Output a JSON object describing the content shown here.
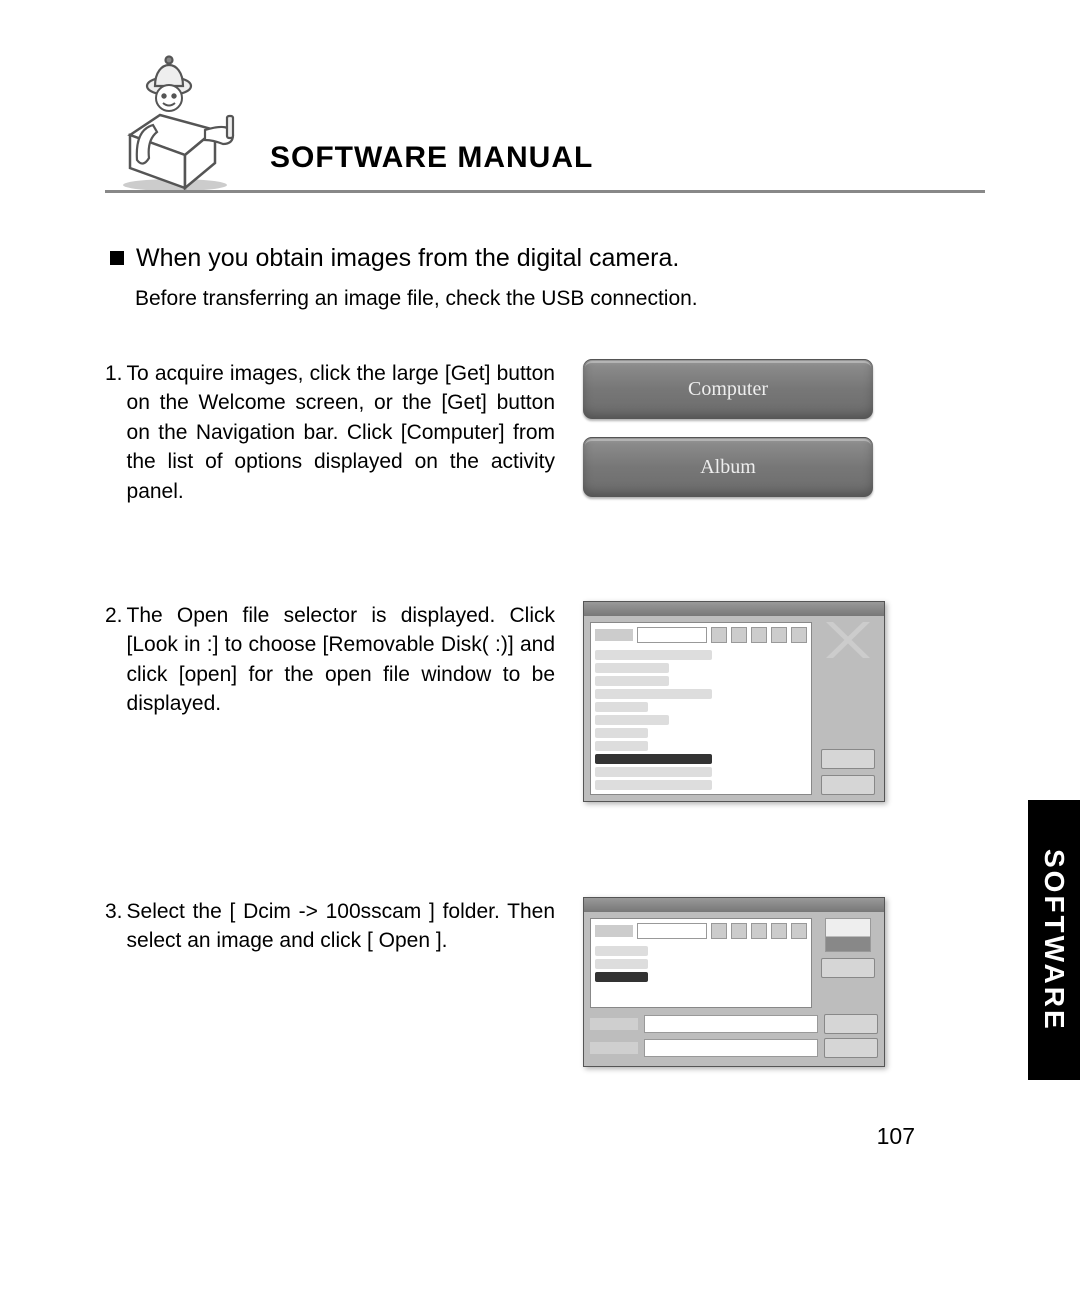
{
  "header": {
    "title": "SOFTWARE MANUAL"
  },
  "section": {
    "heading": "When you obtain images from the digital camera.",
    "intro": "Before transferring an image file, check the USB connection."
  },
  "steps": [
    {
      "num": "1.",
      "text": "To acquire images, click the large [Get] button on the Welcome screen, or the [Get] button on the Navigation bar. Click [Computer] from the list of options displayed on the activity panel."
    },
    {
      "num": "2.",
      "text": "The Open file selector is displayed. Click [Look in :] to choose [Removable Disk( :)] and click [open] for the open file window to be displayed."
    },
    {
      "num": "3.",
      "text": "Select the [ Dcim -> 100sscam ] folder. Then select an image and click [ Open ]."
    }
  ],
  "buttons": {
    "computer": "Computer",
    "album": "Album"
  },
  "sideTab": "SOFTWARE",
  "pageNumber": "107"
}
